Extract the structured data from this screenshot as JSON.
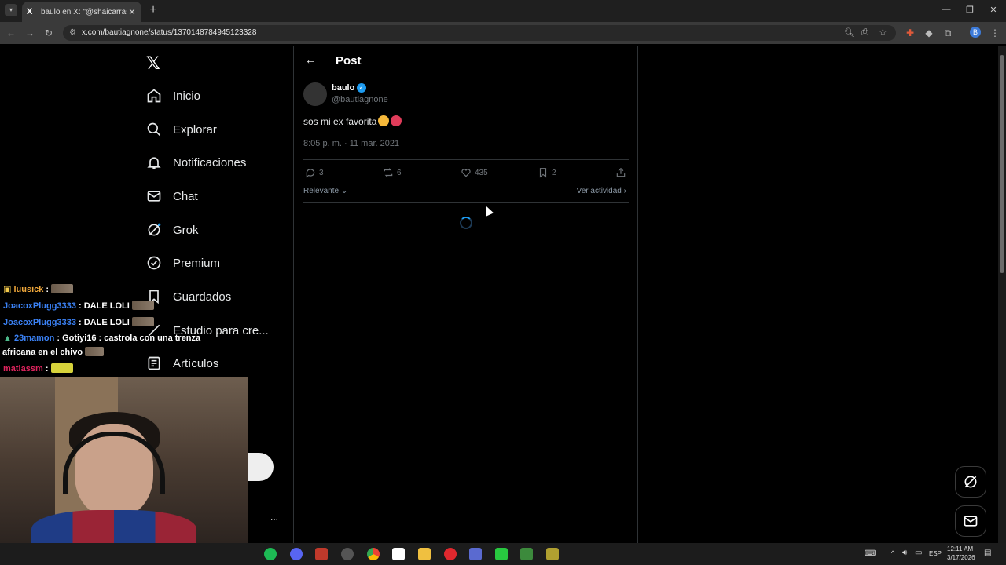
{
  "browser": {
    "tab_title": "baulo en X: \"@shaicarrasco sos…",
    "tab_logo": "X",
    "tab_close": "✕",
    "new_tab": "+",
    "url": "x.com/bautiagnone/status/1370148784945123328",
    "profile_initial": "B"
  },
  "nav": {
    "logo": "𝕏",
    "items": [
      {
        "label": "Inicio",
        "icon": "home-icon"
      },
      {
        "label": "Explorar",
        "icon": "search-icon"
      },
      {
        "label": "Notificaciones",
        "icon": "bell-icon"
      },
      {
        "label": "Chat",
        "icon": "mail-icon"
      },
      {
        "label": "Grok",
        "icon": "grok-icon"
      },
      {
        "label": "Premium",
        "icon": "verified-icon"
      },
      {
        "label": "Guardados",
        "icon": "bookmark-icon"
      },
      {
        "label": "Estudio para cre...",
        "icon": "studio-icon"
      },
      {
        "label": "Artículos",
        "icon": "article-icon"
      }
    ]
  },
  "post": {
    "header_title": "Post",
    "author_name": "baulo",
    "author_handle": "@bautiagnone",
    "text": "sos mi ex favorita",
    "timestamp": "8:05 p. m. · 11 mar. 2021",
    "replies": "3",
    "reposts": "6",
    "likes": "435",
    "bookmarks": "2",
    "sort_label": "Relevante",
    "activity_label": "Ver actividad"
  },
  "chat": [
    {
      "user": "luusick",
      "color": "#f2a93b",
      "message": ""
    },
    {
      "user": "JoacoxPlugg3333",
      "color": "#3b82f6",
      "message": "DALE LOLI"
    },
    {
      "user": "JoacoxPlugg3333",
      "color": "#3b82f6",
      "message": "DALE LOLI"
    },
    {
      "user": "23mamon",
      "color": "#3b82f6",
      "message": "Gotiyi16 : castrola con una trenza"
    },
    {
      "user": "",
      "color": "#ffffff",
      "message": "africana en el chivo"
    },
    {
      "user": "matiassm",
      "color": "#e0245e",
      "message": ""
    }
  ],
  "more_label": "...",
  "taskbar": {
    "lang": "ESP",
    "time": "12:11 AM",
    "date": "3/17/2026"
  }
}
